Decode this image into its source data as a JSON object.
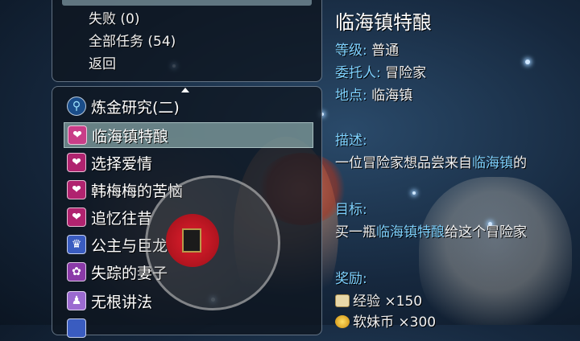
{
  "top_menu": {
    "items": [
      "失败 (0)",
      "全部任务 (54)",
      "返回"
    ]
  },
  "quests": [
    {
      "label": "炼金研究(二)",
      "icon": "magnifier-icon"
    },
    {
      "label": "临海镇特酿",
      "icon": "heart-icon",
      "selected": true
    },
    {
      "label": "选择爱情",
      "icon": "heart-icon"
    },
    {
      "label": "韩梅梅的苦恼",
      "icon": "heart-icon"
    },
    {
      "label": "追忆往昔",
      "icon": "heart-icon"
    },
    {
      "label": "公主与巨龙",
      "icon": "crown-icon"
    },
    {
      "label": "失踪的妻子",
      "icon": "swirl-icon"
    },
    {
      "label": "无根讲法",
      "icon": "people-icon"
    }
  ],
  "detail": {
    "title": "临海镇特酿",
    "level_label": "等级:",
    "level_value": "普通",
    "client_label": "委托人:",
    "client_value": "冒险家",
    "location_label": "地点:",
    "location_value": "临海镇",
    "desc_label": "描述:",
    "desc_prefix": "一位冒险家想品尝来自",
    "desc_highlight": "临海镇",
    "desc_suffix": "的",
    "goal_label": "目标:",
    "goal_prefix": "买一瓶",
    "goal_highlight": "临海镇特酿",
    "goal_suffix": "给这个冒险家",
    "reward_label": "奖励:",
    "reward1": "经验 ×150",
    "reward2": "软妹币 ×300"
  },
  "colors": {
    "label_blue": "#7fd2ff",
    "selected_row": "#96b9b9",
    "joystick_red": "#e21f2e"
  }
}
